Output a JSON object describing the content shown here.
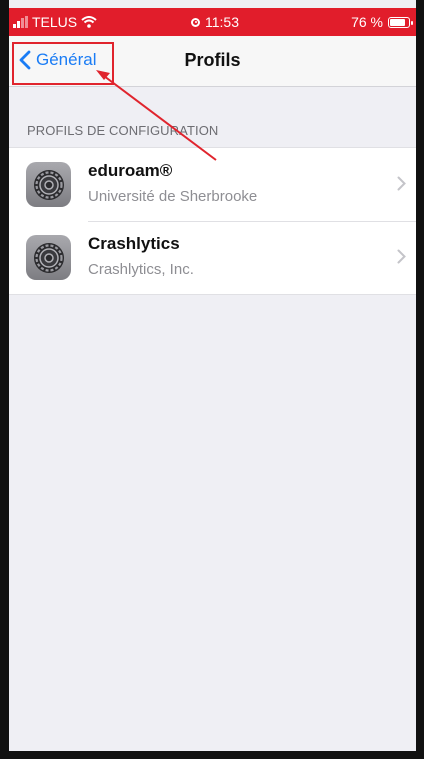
{
  "status_bar": {
    "carrier": "TELUS",
    "time": "11:53",
    "battery": "76 %",
    "battery_level": 0.76
  },
  "nav": {
    "back_label": "Général",
    "title": "Profils"
  },
  "section": {
    "header": "PROFILS DE CONFIGURATION"
  },
  "profiles": [
    {
      "name": "eduroam®",
      "issuer": "Université de Sherbrooke",
      "icon": "settings-gear-icon"
    },
    {
      "name": "Crashlytics",
      "issuer": "Crashlytics, Inc.",
      "icon": "settings-gear-icon"
    }
  ],
  "colors": {
    "status_bar": "#e11d2b",
    "accent": "#1a7cf5",
    "annotation": "#e0242d"
  }
}
